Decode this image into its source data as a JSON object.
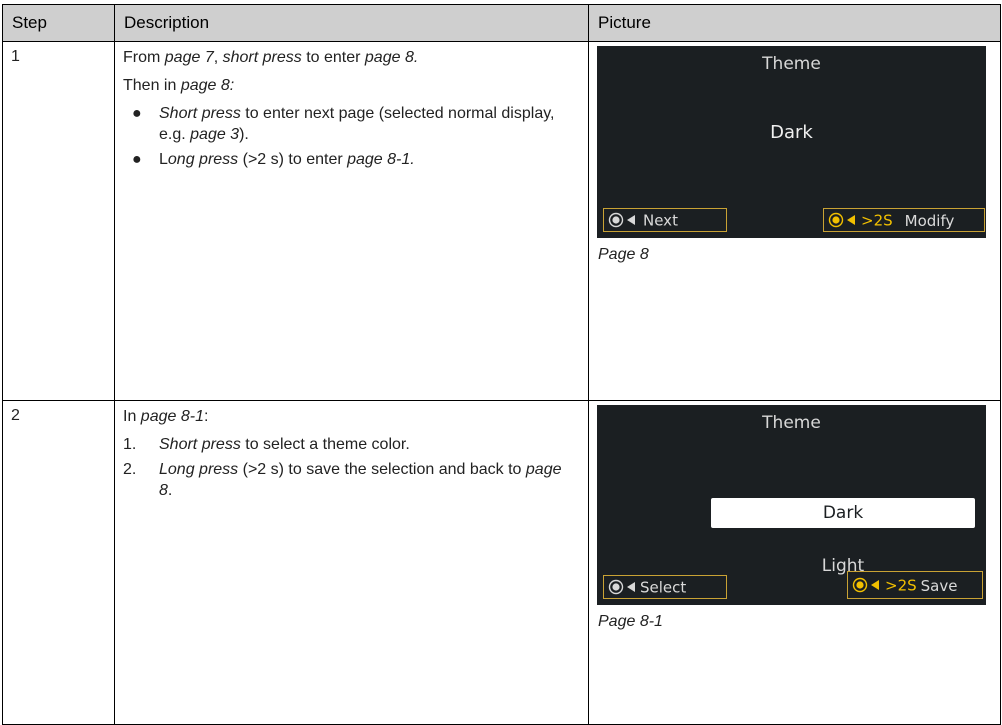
{
  "header": {
    "step": "Step",
    "description": "Description",
    "picture": "Picture"
  },
  "rows": [
    {
      "step": "1",
      "line1": {
        "t1": "From ",
        "i1": "page 7",
        "t2": ", ",
        "i2": "short press",
        "t3": " to enter ",
        "i3": "page 8."
      },
      "line2": {
        "t1": "Then in ",
        "i1": "page 8:"
      },
      "bullets": [
        {
          "i1": "Short press",
          "t1": " to enter next page (selected normal display, e.g. ",
          "i2": "page 3",
          "t2": ")."
        },
        {
          "t0": "L",
          "i1": "ong press",
          "t1": " (>2 s) to enter ",
          "i2": "page 8-1."
        }
      ],
      "screen": {
        "title": "Theme",
        "value": "Dark",
        "left_button": "Next",
        "right_time": ">2S",
        "right_button": "Modify"
      },
      "caption": "Page 8"
    },
    {
      "step": "2",
      "line1": {
        "t1": "In ",
        "i1": "page 8-1",
        "t2": ":"
      },
      "items": [
        {
          "n": "1.",
          "i1": "Short press",
          "t1": " to select a theme color."
        },
        {
          "n": "2.",
          "i1": "Long press",
          "t1": " (>2 s) to save the selection and back to ",
          "i2": "page 8",
          "t2": "."
        }
      ],
      "screen": {
        "title": "Theme",
        "option_selected": "Dark",
        "option_other": "Light",
        "left_button": "Select",
        "right_time": ">2S",
        "right_button": "Save"
      },
      "caption": "Page 8-1"
    }
  ],
  "bullet_glyph": "●",
  "colors": {
    "screen_bg": "#1b1f22",
    "button_border": "#c9a234",
    "accent_gold": "#f2c000",
    "header_bg": "#cfcfcf"
  },
  "icons": [
    "button-press-icon",
    "back-arrow-icon"
  ]
}
